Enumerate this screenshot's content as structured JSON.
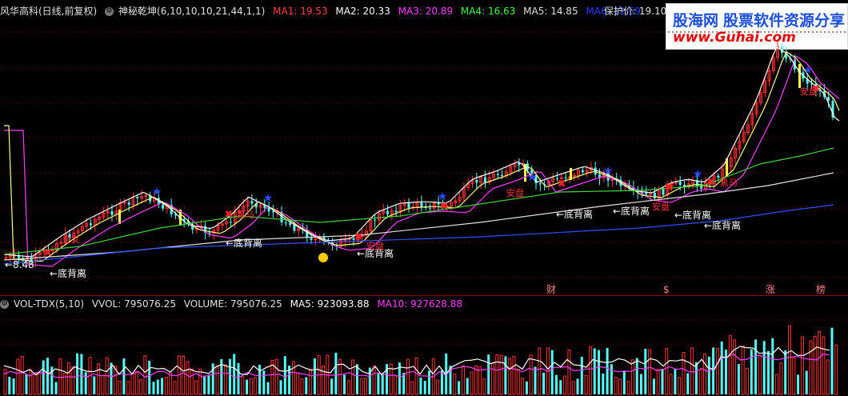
{
  "header": {
    "stock_name": "风华高科(日线,前复权)",
    "indicator_name": "神秘乾坤(6,10,10,10,21,44,1,1)",
    "ma": [
      {
        "label": "MA1: 19.53",
        "color": "#ff4040"
      },
      {
        "label": "MA2: 20.33",
        "color": "#ffffff"
      },
      {
        "label": "MA3: 20.89",
        "color": "#ff40ff"
      },
      {
        "label": "MA4: 16.63",
        "color": "#40ff40"
      },
      {
        "label": "MA5: 14.85",
        "color": "#e0e0e0"
      },
      {
        "label": "MA6: 12.59",
        "color": "#2040ff"
      }
    ],
    "protect_price": "保护价: 19.10"
  },
  "logo": {
    "brand": "股海网",
    "slogan": "股票软件资源分享",
    "url": "www.Guhai.com"
  },
  "volume_header": {
    "name": "VOL-TDX(5,10)",
    "vvol": "VVOL: 795076.25",
    "volume": "VOLUME: 795076.25",
    "ma5": "MA5: 923093.88",
    "ma10": "MA10: 927628.88",
    "ma5_color": "#ffffff",
    "ma10_color": "#ff40ff"
  },
  "labels": {
    "low_price": "←8.48",
    "bottom_divergence": "←底背离",
    "signal_a": "金叉",
    "signal_b": "安盘",
    "signal_c": "黑马",
    "signal_d": "加仓",
    "event_markers": [
      "财",
      "$",
      "涨",
      "榜"
    ]
  },
  "colors": {
    "up": "#ff3232",
    "down": "#54ffff",
    "background": "#000000",
    "divergence_text": "#ffffff",
    "star": "#2a4bff"
  }
}
